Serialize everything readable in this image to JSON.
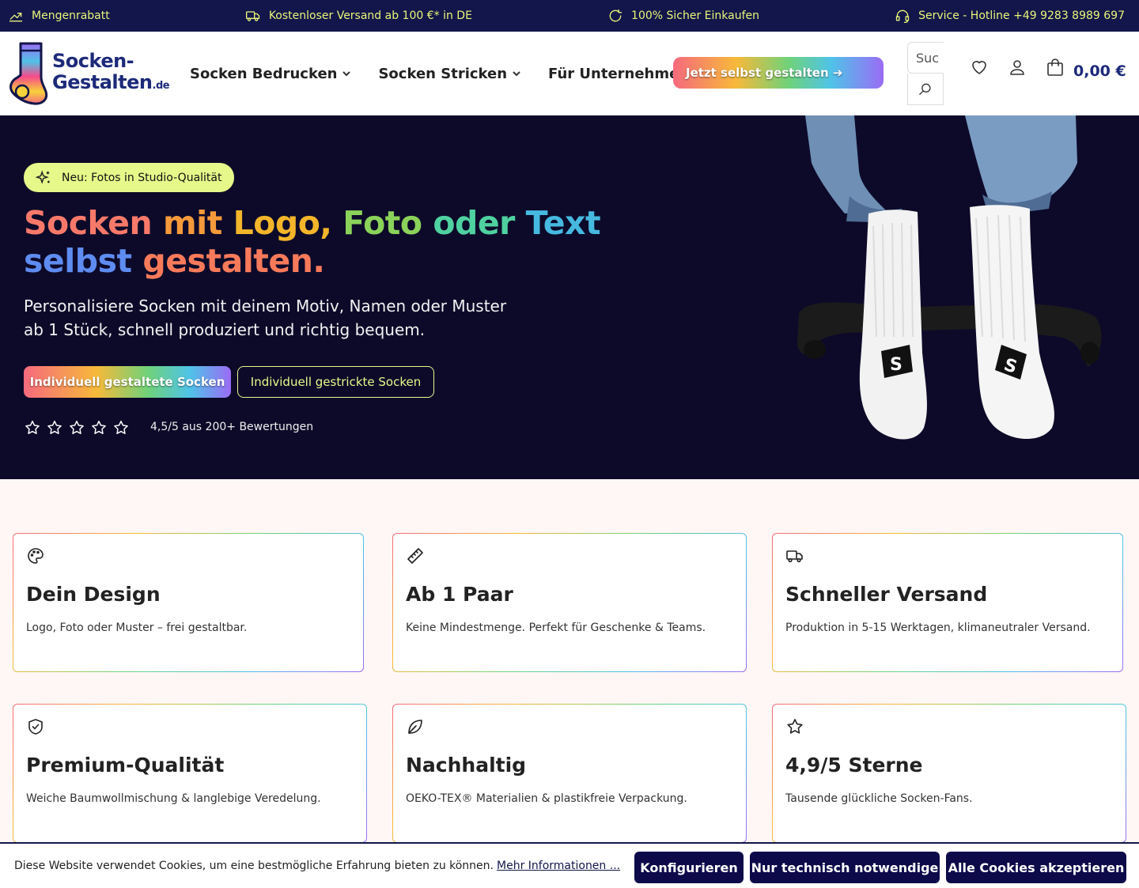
{
  "topbar": {
    "items": [
      {
        "icon": "trending-up-icon",
        "label": "Mengenrabatt"
      },
      {
        "icon": "truck-icon",
        "label": "Kostenloser Versand ab 100 €* in DE"
      },
      {
        "icon": "refresh-icon",
        "label": "100% Sicher Einkaufen"
      },
      {
        "icon": "headset-icon",
        "label": "Service - Hotline +49 9283 8989 697"
      }
    ]
  },
  "header": {
    "logo_line1": "Socken-",
    "logo_line2": "Gestalten",
    "logo_tld": ".de",
    "nav": [
      {
        "label": "Socken Bedrucken"
      },
      {
        "label": "Socken Stricken"
      },
      {
        "label": "Für Unternehmen"
      }
    ],
    "cta_label": "Jetzt selbst gestalten ➔",
    "search_placeholder": "Suchen...",
    "search_visible": "Suc",
    "cart_total": "0,00 €"
  },
  "hero": {
    "badge": "Neu: Fotos in Studio-Qualität",
    "headline_words": [
      "Socken",
      "mit",
      "Logo,",
      "Foto",
      "oder",
      "Text",
      "selbst",
      "gestalten."
    ],
    "headline_colors": [
      "#f8796a",
      "#f59a3a",
      "#f3b52a",
      "#8bd25a",
      "#4fd1a0",
      "#46b9e0",
      "#5e8cf0",
      "#f87a5a"
    ],
    "subline": "Personalisiere Socken mit deinem Motiv, Namen oder Muster ab 1 Stück, schnell produziert und richtig bequem.",
    "button_primary": "Individuell gestaltete Socken",
    "button_secondary": "Individuell gestrickte Socken",
    "star_count": 5,
    "rating_text": "4,5/5 aus 200+ Bewertungen"
  },
  "features": [
    {
      "icon": "palette-icon",
      "title": "Dein Design",
      "text": "Logo, Foto oder Muster – frei gestaltbar."
    },
    {
      "icon": "ruler-icon",
      "title": "Ab 1 Paar",
      "text": "Keine Mindestmenge. Perfekt für Geschenke & Teams."
    },
    {
      "icon": "truck-icon",
      "title": "Schneller Versand",
      "text": "Produktion in 5-15 Werktagen, klimaneutraler Versand."
    },
    {
      "icon": "shield-check-icon",
      "title": "Premium-Qualität",
      "text": "Weiche Baumwollmischung & langlebige Veredelung."
    },
    {
      "icon": "leaf-icon",
      "title": "Nachhaltig",
      "text": "OEKO-TEX® Materialien & plastikfreie Verpackung."
    },
    {
      "icon": "star-icon",
      "title": "4,9/5 Sterne",
      "text": "Tausende glückliche Socken-Fans."
    }
  ],
  "cookie": {
    "text": "Diese Website verwendet Cookies, um eine bestmögliche Erfahrung bieten zu können.",
    "link": "Mehr Informationen ...",
    "btn_configure": "Konfigurieren",
    "btn_necessary": "Nur technisch notwendige",
    "btn_accept": "Alle Cookies akzeptieren"
  },
  "colors": {
    "topbar_bg": "#13164a",
    "accent_yellow": "#e6f88a",
    "hero_bg": "#0d0a29",
    "brand_blue": "#1d2a7a"
  }
}
